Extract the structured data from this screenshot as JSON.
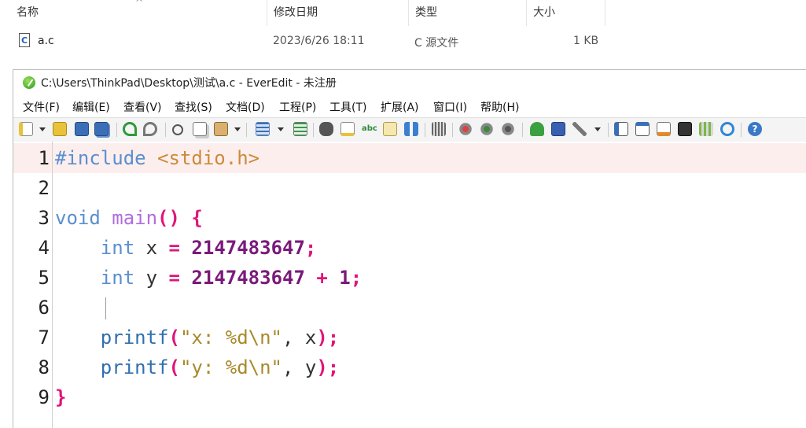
{
  "explorer": {
    "columns": [
      {
        "label": "名称"
      },
      {
        "label": "修改日期"
      },
      {
        "label": "类型"
      },
      {
        "label": "大小"
      }
    ],
    "sort_indicator": "^",
    "file": {
      "name": "a.c",
      "modified": "2023/6/26 18:11",
      "type": "C 源文件",
      "size": "1 KB"
    }
  },
  "window": {
    "title": "C:\\Users\\ThinkPad\\Desktop\\测试\\a.c - EverEdit - 未注册",
    "menu": [
      "文件(F)",
      "编辑(E)",
      "查看(V)",
      "查找(S)",
      "文档(D)",
      "工程(P)",
      "工具(T)",
      "扩展(A)",
      "窗口(I)",
      "帮助(H)"
    ],
    "toolbar_icons": [
      "new-icon",
      "open-icon",
      "save-icon",
      "save-all-icon",
      "undo-icon",
      "redo-icon",
      "cut-icon",
      "copy-icon",
      "paste-icon",
      "wrap-icon",
      "hex-icon",
      "find-icon",
      "replace-icon",
      "spell-icon",
      "find-in-files-icon",
      "structure-icon",
      "column-icon",
      "macro-record-icon",
      "macro-play-icon",
      "macro-stop-icon",
      "plugin-icon",
      "window-icon",
      "tools-icon",
      "outline-icon",
      "split-icon",
      "document-icon",
      "console-icon",
      "clip-icon",
      "browser-icon",
      "help-icon"
    ]
  },
  "editor": {
    "current_line": 1,
    "lines": [
      {
        "n": "1",
        "tokens": [
          {
            "t": "#include",
            "c": "pp"
          },
          {
            "t": " ",
            "c": ""
          },
          {
            "t": "<stdio.h>",
            "c": "hdr"
          }
        ]
      },
      {
        "n": "2",
        "tokens": []
      },
      {
        "n": "3",
        "tokens": [
          {
            "t": "void",
            "c": "kw"
          },
          {
            "t": " ",
            "c": ""
          },
          {
            "t": "main",
            "c": "fn"
          },
          {
            "t": "()",
            "c": "op"
          },
          {
            "t": " ",
            "c": ""
          },
          {
            "t": "{",
            "c": "op"
          }
        ]
      },
      {
        "n": "4",
        "tokens": [
          {
            "t": "    ",
            "c": ""
          },
          {
            "t": "int",
            "c": "kw"
          },
          {
            "t": " ",
            "c": ""
          },
          {
            "t": "x",
            "c": "var"
          },
          {
            "t": " ",
            "c": ""
          },
          {
            "t": "=",
            "c": "op"
          },
          {
            "t": " ",
            "c": ""
          },
          {
            "t": "2147483647",
            "c": "num"
          },
          {
            "t": ";",
            "c": "op"
          }
        ]
      },
      {
        "n": "5",
        "tokens": [
          {
            "t": "    ",
            "c": ""
          },
          {
            "t": "int",
            "c": "kw"
          },
          {
            "t": " ",
            "c": ""
          },
          {
            "t": "y",
            "c": "var"
          },
          {
            "t": " ",
            "c": ""
          },
          {
            "t": "=",
            "c": "op"
          },
          {
            "t": " ",
            "c": ""
          },
          {
            "t": "2147483647",
            "c": "num"
          },
          {
            "t": " ",
            "c": ""
          },
          {
            "t": "+",
            "c": "op"
          },
          {
            "t": " ",
            "c": ""
          },
          {
            "t": "1",
            "c": "num"
          },
          {
            "t": ";",
            "c": "op"
          }
        ]
      },
      {
        "n": "6",
        "tokens": []
      },
      {
        "n": "7",
        "tokens": [
          {
            "t": "    ",
            "c": ""
          },
          {
            "t": "printf",
            "c": "func"
          },
          {
            "t": "(",
            "c": "op"
          },
          {
            "t": "\"x: %d\\n\"",
            "c": "str"
          },
          {
            "t": ", ",
            "c": "var"
          },
          {
            "t": "x",
            "c": "var"
          },
          {
            "t": ");",
            "c": "op"
          }
        ]
      },
      {
        "n": "8",
        "tokens": [
          {
            "t": "    ",
            "c": ""
          },
          {
            "t": "printf",
            "c": "func"
          },
          {
            "t": "(",
            "c": "op"
          },
          {
            "t": "\"y: %d\\n\"",
            "c": "str"
          },
          {
            "t": ", ",
            "c": "var"
          },
          {
            "t": "y",
            "c": "var"
          },
          {
            "t": ");",
            "c": "op"
          }
        ]
      },
      {
        "n": "9",
        "tokens": [
          {
            "t": "}",
            "c": "op"
          }
        ]
      }
    ]
  }
}
